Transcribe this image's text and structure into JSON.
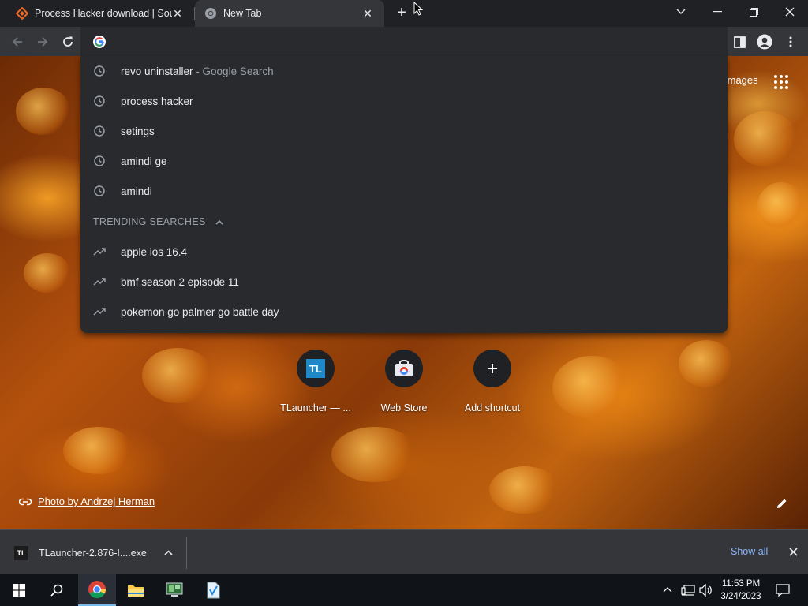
{
  "browser": {
    "tabs": [
      {
        "title": "Process Hacker download | SourceForge",
        "active": false
      },
      {
        "title": "New Tab",
        "active": true
      }
    ]
  },
  "omnibox": {
    "value": "",
    "suggestions": [
      {
        "text": "revo uninstaller",
        "hint": " - Google Search",
        "icon": "history-icon"
      },
      {
        "text": "process hacker",
        "hint": "",
        "icon": "history-icon"
      },
      {
        "text": "setings",
        "hint": "",
        "icon": "history-icon"
      },
      {
        "text": "amindi ge",
        "hint": "",
        "icon": "history-icon"
      },
      {
        "text": "amindi",
        "hint": "",
        "icon": "history-icon"
      }
    ],
    "trending_header": "TRENDING SEARCHES",
    "trending": [
      {
        "text": "apple ios 16.4",
        "icon": "trending-icon"
      },
      {
        "text": "bmf season 2 episode 11",
        "icon": "trending-icon"
      },
      {
        "text": "pokemon go palmer go battle day",
        "icon": "trending-icon"
      }
    ]
  },
  "new_tab": {
    "images_link": "Images",
    "shortcuts": [
      {
        "label": "TLauncher — ...",
        "icon": "tlauncher-icon",
        "badge": "TL"
      },
      {
        "label": "Web Store",
        "icon": "webstore-icon"
      },
      {
        "label": "Add shortcut",
        "icon": "add-icon"
      }
    ],
    "photo_credit": "Photo by Andrzej Herman"
  },
  "download_bar": {
    "file_name": "TLauncher-2.876-I....exe",
    "file_badge": "TL",
    "show_all": "Show all"
  },
  "taskbar": {
    "time": "11:53 PM",
    "date": "3/24/2023"
  },
  "colors": {
    "chrome_dark": "#202124",
    "toolbar": "#35363a",
    "dropdown": "#292a2d",
    "link_blue": "#8ab4f8",
    "tlauncher_blue": "#1e88c8"
  }
}
